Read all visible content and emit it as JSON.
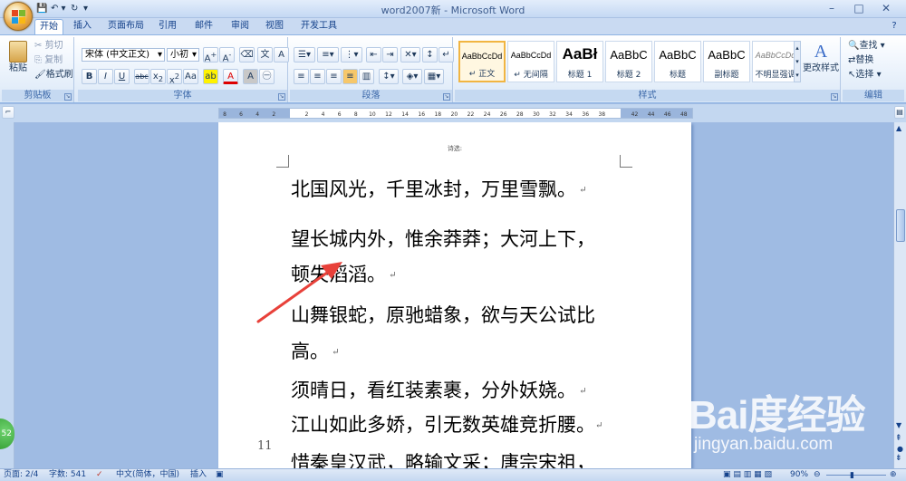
{
  "app": {
    "window_title": "word2007新 - Microsoft Word",
    "window_buttons": [
      "–",
      "□",
      "✕"
    ]
  },
  "tabs": [
    {
      "label": "开始",
      "active": true
    },
    {
      "label": "插入",
      "active": false
    },
    {
      "label": "页面布局",
      "active": false
    },
    {
      "label": "引用",
      "active": false
    },
    {
      "label": "邮件",
      "active": false
    },
    {
      "label": "审阅",
      "active": false
    },
    {
      "label": "视图",
      "active": false
    },
    {
      "label": "开发工具",
      "active": false
    }
  ],
  "ribbon": {
    "clipboard": {
      "group_label": "剪贴板",
      "paste": "粘贴",
      "cut": "剪切",
      "copy": "复制",
      "format_painter": "格式刷"
    },
    "font": {
      "group_label": "字体",
      "font_name": "宋体 (中文正文)",
      "font_size": "小初"
    },
    "paragraph": {
      "group_label": "段落"
    },
    "styles": {
      "group_label": "样式",
      "tiles": [
        {
          "preview": "AaBbCcDd",
          "name": "↵ 正文",
          "selected": true
        },
        {
          "preview": "AaBbCcDd",
          "name": "↵ 无间隔",
          "selected": false
        },
        {
          "preview": "AaBł",
          "name": "标题 1",
          "selected": false
        },
        {
          "preview": "AaBbC",
          "name": "标题 2",
          "selected": false
        },
        {
          "preview": "AaBbC",
          "name": "标题",
          "selected": false
        },
        {
          "preview": "AaBbC",
          "name": "副标题",
          "selected": false
        },
        {
          "preview": "AaBbCcDd",
          "name": "不明显强调",
          "selected": false
        }
      ],
      "change_styles": "更改样式"
    },
    "editing": {
      "group_label": "编辑",
      "find": "查找",
      "replace": "替换",
      "select": "选择"
    }
  },
  "ruler": {
    "ticks": [
      "8",
      "6",
      "4",
      "2",
      "",
      "2",
      "4",
      "6",
      "8",
      "10",
      "12",
      "14",
      "16",
      "18",
      "20",
      "22",
      "24",
      "26",
      "28",
      "30",
      "32",
      "34",
      "36",
      "38",
      "",
      "42",
      "44",
      "46",
      "48"
    ]
  },
  "document": {
    "header_text": "诗选:",
    "paragraphs": [
      "北国风光，千里冰封，万里雪飘。",
      "望长城内外，惟余莽莽；大河上下，",
      "顿失滔滔。",
      "山舞银蛇，原驰蜡象，欲与天公试比",
      "高。",
      "须晴日，看红装素裹，分外妖娆。",
      "江山如此多娇，引无数英雄竞折腰。",
      "惜秦皇汉武，略输文采；唐宗宋祖，"
    ],
    "line_number": "11"
  },
  "status_bar": {
    "page": "页面: 2/4",
    "word_count": "字数: 541",
    "language": "中文(简体，中国)",
    "mode": "插入",
    "zoom": "90%"
  },
  "watermark": {
    "logo": "Bai度经验",
    "url": "jingyan.baidu.com"
  },
  "badge": "52",
  "colors": {
    "accent": "#15428b",
    "arrow": "#e8413a",
    "ribbon_bg": "#dbe8f7",
    "workspace": "#9fbbe3"
  }
}
